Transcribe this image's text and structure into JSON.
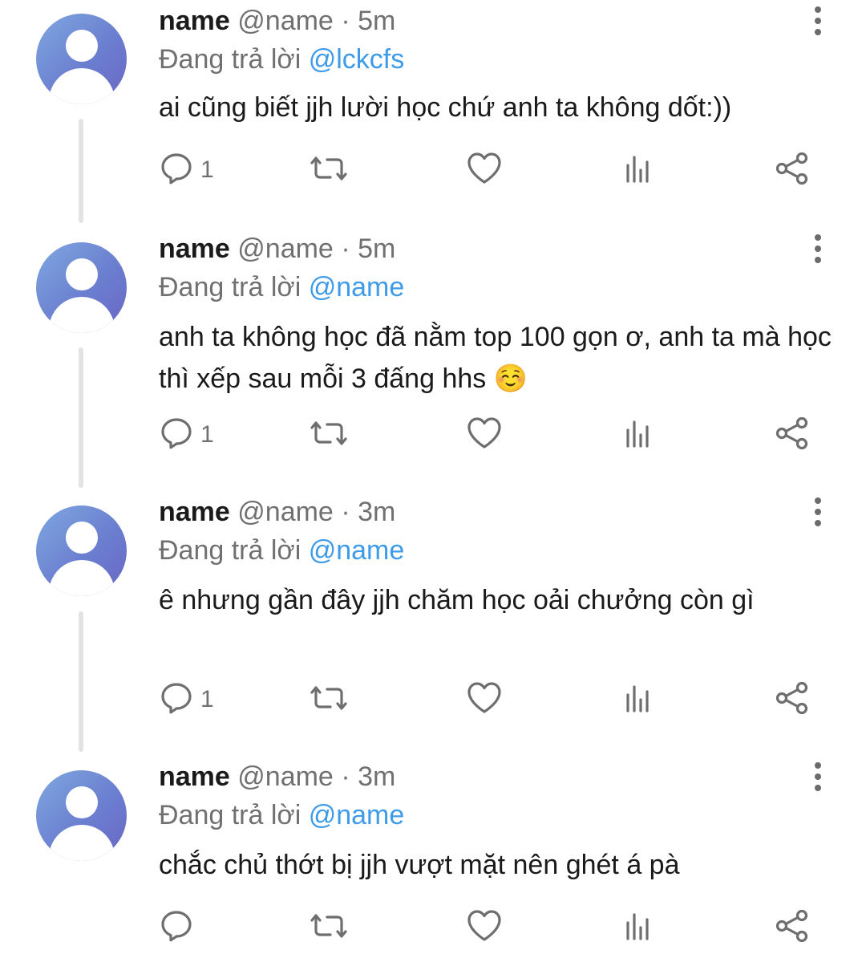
{
  "colors": {
    "mention": "#3d9be9",
    "muted": "#707070",
    "text": "#1a1a1a",
    "line": "#e3e3e3"
  },
  "tweets": [
    {
      "name": "name",
      "handle": "@name",
      "sep": "·",
      "time": "5m",
      "reply_prefix": "Đang trả lời",
      "reply_to": "@lckcfs",
      "text": "ai cũng biết jjh lười học chứ anh ta không dốt:))",
      "reply_count": "1"
    },
    {
      "name": "name",
      "handle": "@name",
      "sep": "·",
      "time": "5m",
      "reply_prefix": "Đang trả lời",
      "reply_to": "@name",
      "text": "anh ta không học đã nằm top 100 gọn ơ, anh ta mà học thì xếp sau mỗi 3 đấng hhs ☺️",
      "reply_count": "1"
    },
    {
      "name": "name",
      "handle": "@name",
      "sep": "·",
      "time": "3m",
      "reply_prefix": "Đang trả lời",
      "reply_to": "@name",
      "text": "ê nhưng gần đây jjh chăm học oải chưởng còn gì",
      "reply_count": "1"
    },
    {
      "name": "name",
      "handle": "@name",
      "sep": "·",
      "time": "3m",
      "reply_prefix": "Đang trả lời",
      "reply_to": "@name",
      "text": "chắc chủ thớt bị jjh vượt mặt nên ghét á pà",
      "reply_count": ""
    }
  ],
  "icons": {
    "reply": "reply-icon",
    "retweet": "retweet-icon",
    "like": "heart-icon",
    "stats": "stats-icon",
    "share": "share-icon",
    "more": "more-vertical-icon"
  }
}
